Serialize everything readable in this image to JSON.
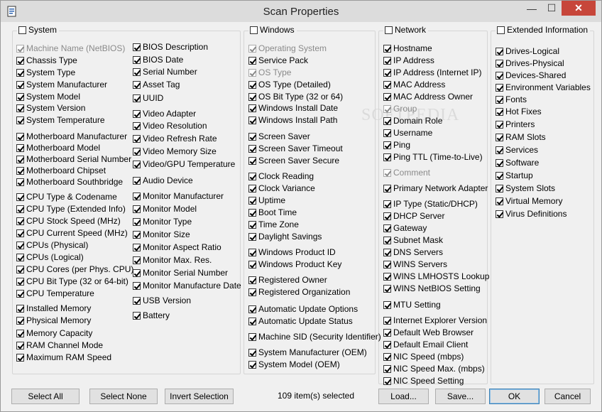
{
  "window": {
    "title": "Scan Properties",
    "minimize": "—",
    "maximize": "☐",
    "close": "✕"
  },
  "groups": [
    {
      "caption": "System",
      "caption_checked": false,
      "items": [
        {
          "label": "Machine Name (NetBIOS)",
          "checked": true,
          "disabled": true
        },
        {
          "label": "Chassis Type",
          "checked": true
        },
        {
          "label": "System Type",
          "checked": true
        },
        {
          "label": "System Manufacturer",
          "checked": true
        },
        {
          "label": "System Model",
          "checked": true
        },
        {
          "label": "System Version",
          "checked": true
        },
        {
          "label": "System Temperature",
          "checked": true
        },
        {
          "label": "Motherboard Manufacturer",
          "checked": true
        },
        {
          "label": "Motherboard Model",
          "checked": true
        },
        {
          "label": "Motherboard Serial Number",
          "checked": true
        },
        {
          "label": "Motherboard Chipset",
          "checked": true
        },
        {
          "label": "Motherboard Southbridge",
          "checked": true
        },
        {
          "label": "CPU Type & Codename",
          "checked": true
        },
        {
          "label": "CPU Type (Extended Info)",
          "checked": true
        },
        {
          "label": "CPU Stock Speed (MHz)",
          "checked": true
        },
        {
          "label": "CPU Current Speed (MHz)",
          "checked": true
        },
        {
          "label": "CPUs (Physical)",
          "checked": true
        },
        {
          "label": "CPUs (Logical)",
          "checked": true
        },
        {
          "label": "CPU Cores (per Phys. CPU)",
          "checked": true
        },
        {
          "label": "CPU Bit Type (32 or 64-bit)",
          "checked": true
        },
        {
          "label": "CPU Temperature",
          "checked": true
        },
        {
          "label": "Installed Memory",
          "checked": true
        },
        {
          "label": "Physical Memory",
          "checked": true
        },
        {
          "label": "Memory Capacity",
          "checked": true
        },
        {
          "label": "RAM Channel Mode",
          "checked": true
        },
        {
          "label": "Maximum RAM Speed",
          "checked": true
        },
        {
          "label": "BIOS Description",
          "checked": true
        },
        {
          "label": "BIOS Date",
          "checked": true
        },
        {
          "label": "Serial Number",
          "checked": true
        },
        {
          "label": "Asset Tag",
          "checked": true
        },
        {
          "label": "UUID",
          "checked": true
        },
        {
          "label": "Video Adapter",
          "checked": true
        },
        {
          "label": "Video Resolution",
          "checked": true
        },
        {
          "label": "Video Refresh Rate",
          "checked": true
        },
        {
          "label": "Video Memory Size",
          "checked": true
        },
        {
          "label": "Video/GPU Temperature",
          "checked": true
        },
        {
          "label": "Audio Device",
          "checked": true
        },
        {
          "label": "Monitor Manufacturer",
          "checked": true
        },
        {
          "label": "Monitor Model",
          "checked": true
        },
        {
          "label": "Monitor Type",
          "checked": true
        },
        {
          "label": "Monitor Size",
          "checked": true
        },
        {
          "label": "Monitor Aspect Ratio",
          "checked": true
        },
        {
          "label": "Monitor Max. Res.",
          "checked": true
        },
        {
          "label": "Monitor Serial Number",
          "checked": true
        },
        {
          "label": "Monitor Manufacture Date",
          "checked": true
        },
        {
          "label": "USB Version",
          "checked": true
        },
        {
          "label": "Battery",
          "checked": true
        }
      ]
    },
    {
      "caption": "Windows",
      "caption_checked": false,
      "items": [
        {
          "label": "Operating System",
          "checked": true,
          "disabled": true
        },
        {
          "label": "Service Pack",
          "checked": true
        },
        {
          "label": "OS Type",
          "checked": true,
          "disabled": true
        },
        {
          "label": "OS Type (Detailed)",
          "checked": true
        },
        {
          "label": "OS Bit Type (32 or 64)",
          "checked": true
        },
        {
          "label": "Windows Install Date",
          "checked": true
        },
        {
          "label": "Windows Install Path",
          "checked": true
        },
        {
          "label": "Screen Saver",
          "checked": true
        },
        {
          "label": "Screen Saver Timeout",
          "checked": true
        },
        {
          "label": "Screen Saver Secure",
          "checked": true
        },
        {
          "label": "Clock Reading",
          "checked": true
        },
        {
          "label": "Clock Variance",
          "checked": true
        },
        {
          "label": "Uptime",
          "checked": true
        },
        {
          "label": "Boot Time",
          "checked": true
        },
        {
          "label": "Time Zone",
          "checked": true
        },
        {
          "label": "Daylight Savings",
          "checked": true
        },
        {
          "label": "Windows Product ID",
          "checked": true
        },
        {
          "label": "Windows Product Key",
          "checked": true
        },
        {
          "label": "Registered Owner",
          "checked": true
        },
        {
          "label": "Registered Organization",
          "checked": true
        },
        {
          "label": "Automatic Update Options",
          "checked": true
        },
        {
          "label": "Automatic Update Status",
          "checked": true
        },
        {
          "label": "Machine SID (Security Identifier)",
          "checked": true
        },
        {
          "label": "System Manufacturer (OEM)",
          "checked": true
        },
        {
          "label": "System Model (OEM)",
          "checked": true
        }
      ]
    },
    {
      "caption": "Network",
      "caption_checked": false,
      "items": [
        {
          "label": "Hostname",
          "checked": true
        },
        {
          "label": "IP Address",
          "checked": true
        },
        {
          "label": "IP Address (Internet IP)",
          "checked": true
        },
        {
          "label": "MAC Address",
          "checked": true
        },
        {
          "label": "MAC Address Owner",
          "checked": true
        },
        {
          "label": "Group",
          "checked": true,
          "disabled": true
        },
        {
          "label": "Domain Role",
          "checked": true
        },
        {
          "label": "Username",
          "checked": true
        },
        {
          "label": "Ping",
          "checked": true
        },
        {
          "label": "Ping TTL (Time-to-Live)",
          "checked": true
        },
        {
          "label": "Comment",
          "checked": true,
          "disabled": true
        },
        {
          "label": "Primary Network Adapter",
          "checked": true
        },
        {
          "label": "IP Type (Static/DHCP)",
          "checked": true
        },
        {
          "label": "DHCP Server",
          "checked": true
        },
        {
          "label": "Gateway",
          "checked": true
        },
        {
          "label": "Subnet Mask",
          "checked": true
        },
        {
          "label": "DNS Servers",
          "checked": true
        },
        {
          "label": "WINS Servers",
          "checked": true
        },
        {
          "label": "WINS LMHOSTS Lookup",
          "checked": true
        },
        {
          "label": "WINS NetBIOS Setting",
          "checked": true
        },
        {
          "label": "MTU Setting",
          "checked": true
        },
        {
          "label": "Internet Explorer Version",
          "checked": true
        },
        {
          "label": "Default Web Browser",
          "checked": true
        },
        {
          "label": "Default Email Client",
          "checked": true
        },
        {
          "label": "NIC Speed (mbps)",
          "checked": true
        },
        {
          "label": "NIC Speed Max. (mbps)",
          "checked": true
        },
        {
          "label": "NIC Speed Setting",
          "checked": true
        }
      ]
    },
    {
      "caption": "Extended Information",
      "caption_checked": false,
      "items": [
        {
          "label": "Drives-Logical",
          "checked": true
        },
        {
          "label": "Drives-Physical",
          "checked": true
        },
        {
          "label": "Devices-Shared",
          "checked": true
        },
        {
          "label": "Environment Variables",
          "checked": true
        },
        {
          "label": "Fonts",
          "checked": true
        },
        {
          "label": "Hot Fixes",
          "checked": true
        },
        {
          "label": "Printers",
          "checked": true
        },
        {
          "label": "RAM Slots",
          "checked": true
        },
        {
          "label": "Services",
          "checked": true
        },
        {
          "label": "Software",
          "checked": true
        },
        {
          "label": "Startup",
          "checked": true
        },
        {
          "label": "System Slots",
          "checked": true
        },
        {
          "label": "Virtual Memory",
          "checked": true
        },
        {
          "label": "Virus Definitions",
          "checked": true
        }
      ]
    }
  ],
  "footer": {
    "select_all": "Select All",
    "select_none": "Select None",
    "invert_selection": "Invert Selection",
    "status": "109 item(s) selected",
    "load": "Load...",
    "save": "Save...",
    "ok": "OK",
    "cancel": "Cancel"
  },
  "watermark": "SOFTPEDIA"
}
